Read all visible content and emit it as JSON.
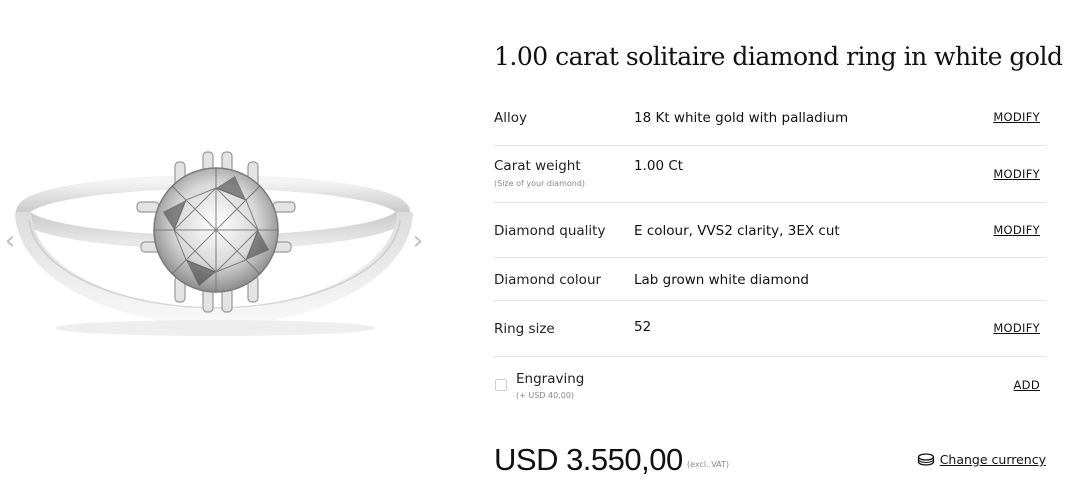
{
  "gallery": {
    "image_alt": "1.00 carat solitaire diamond ring in white gold",
    "prev_icon": "‹",
    "next_icon": "›"
  },
  "product": {
    "title": "1.00 carat solitaire diamond ring in white gold"
  },
  "specs": [
    {
      "label": "Alloy",
      "sublabel": "",
      "value": "18 Kt white gold with palladium",
      "action": "MODIFY"
    },
    {
      "label": "Carat weight",
      "sublabel": "(Size of your diamond)",
      "value": "1.00 Ct",
      "action": "MODIFY"
    },
    {
      "label": "Diamond quality",
      "sublabel": "",
      "value": "E colour, VVS2 clarity, 3EX cut",
      "action": "MODIFY"
    },
    {
      "label": "Diamond colour",
      "sublabel": "",
      "value": "Lab grown white diamond",
      "action": ""
    },
    {
      "label": "Ring size",
      "sublabel": "",
      "value": "52",
      "action": "MODIFY"
    }
  ],
  "engraving": {
    "label": "Engraving",
    "sublabel": "(+ USD 40,00)",
    "action": "ADD",
    "checked": false
  },
  "pricing": {
    "price": "USD 3.550,00",
    "vat_note": "(excl. VAT)",
    "currency_label": "Change currency",
    "currency_icon": "coins-icon"
  }
}
